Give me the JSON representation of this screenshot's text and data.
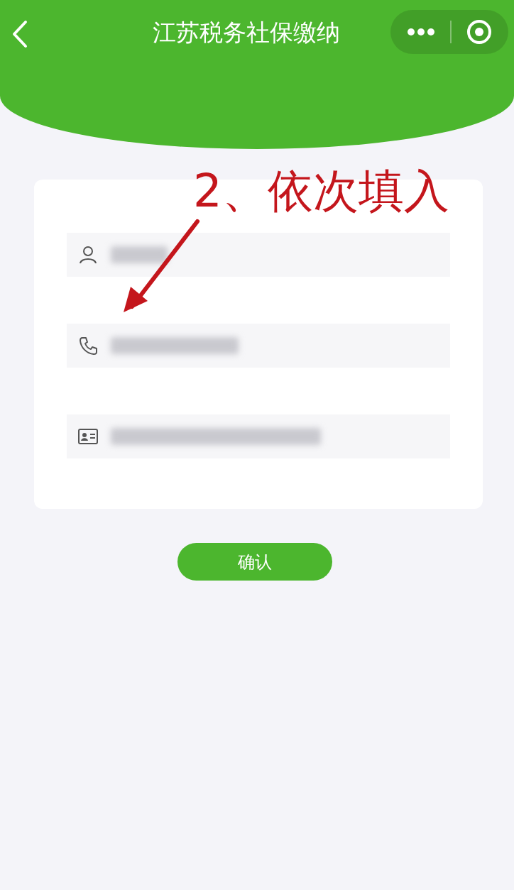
{
  "header": {
    "title": "江苏税务社保缴纳"
  },
  "fields": [
    {
      "kind": "person"
    },
    {
      "kind": "phone"
    },
    {
      "kind": "idcard"
    }
  ],
  "confirm_button": {
    "label": "确认"
  },
  "annotation": {
    "text": "2、依次填入"
  }
}
